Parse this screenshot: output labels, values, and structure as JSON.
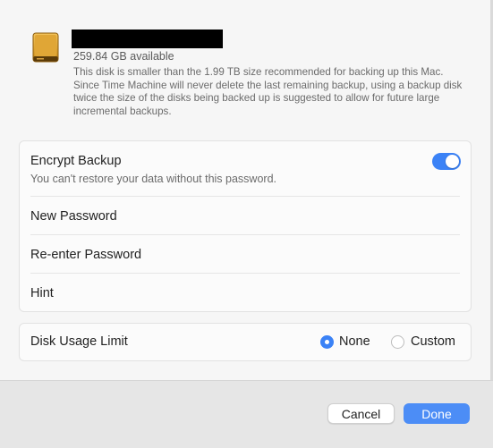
{
  "disk": {
    "available": "259.84 GB available",
    "description": "This disk is smaller than the 1.99 TB size recommended for backing up this Mac. Since Time Machine will never delete the last remaining backup, using a backup disk twice the size of the disks being backed up is suggested to allow for future large incremental backups."
  },
  "encrypt": {
    "label": "Encrypt Backup",
    "sublabel": "You can't restore your data without this password.",
    "enabled": true
  },
  "fields": {
    "new_password": "New Password",
    "reenter_password": "Re-enter Password",
    "hint": "Hint"
  },
  "disk_usage": {
    "label": "Disk Usage Limit",
    "options": [
      "None",
      "Custom"
    ],
    "selected": "None"
  },
  "buttons": {
    "cancel": "Cancel",
    "done": "Done"
  },
  "colors": {
    "accent": "#3b82f6",
    "icon": "disk-icon"
  }
}
